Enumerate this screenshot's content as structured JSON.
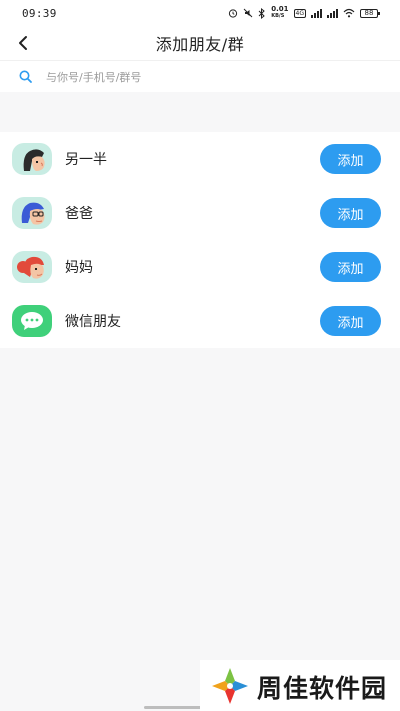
{
  "status_bar": {
    "time": "09:39",
    "net_speed": "0.01",
    "net_unit": "KB/S",
    "battery": "88"
  },
  "header": {
    "title": "添加朋友/群"
  },
  "search": {
    "placeholder": "与你号/手机号/群号"
  },
  "contacts": [
    {
      "label": "另一半",
      "button": "添加",
      "icon": "man-avatar-icon"
    },
    {
      "label": "爸爸",
      "button": "添加",
      "icon": "dad-avatar-icon"
    },
    {
      "label": "妈妈",
      "button": "添加",
      "icon": "mom-avatar-icon"
    },
    {
      "label": "微信朋友",
      "button": "添加",
      "icon": "wechat-icon"
    }
  ],
  "watermark": {
    "text": "周佳软件园"
  },
  "colors": {
    "accent": "#2d9cf0",
    "avatar_bg_teal": "#c8ece3",
    "avatar_bg_blue": "#cfe3f5",
    "wechat_green": "#3fd07a"
  }
}
